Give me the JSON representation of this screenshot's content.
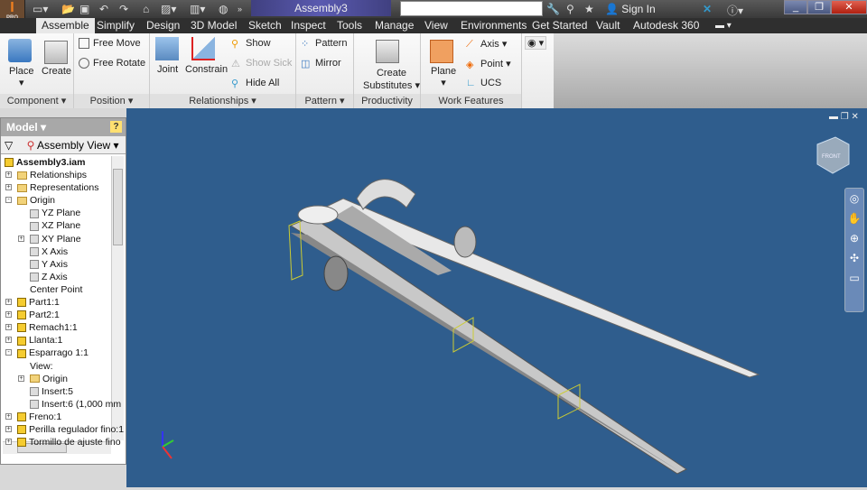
{
  "title_bar": {
    "app_badge": "PRO",
    "document_title": "Assembly3",
    "search_placeholder": "",
    "sign_in": "Sign In"
  },
  "tabs": [
    "Assemble",
    "Simplify",
    "Design",
    "3D Model",
    "Sketch",
    "Inspect",
    "Tools",
    "Manage",
    "View",
    "Environments",
    "Get Started",
    "Vault",
    "Autodesk 360"
  ],
  "active_tab": "Assemble",
  "ribbon": {
    "component": {
      "label": "Component",
      "place": "Place",
      "create": "Create"
    },
    "position": {
      "label": "Position",
      "free_move": "Free Move",
      "free_rotate": "Free Rotate"
    },
    "relationships": {
      "label": "Relationships",
      "joint": "Joint",
      "constrain": "Constrain",
      "show": "Show",
      "show_sick": "Show Sick",
      "hide_all": "Hide All"
    },
    "pattern": {
      "label": "Pattern",
      "pattern": "Pattern",
      "mirror": "Mirror"
    },
    "productivity": {
      "label": "Productivity",
      "create_substitutes_1": "Create",
      "create_substitutes_2": "Substitutes"
    },
    "work_features": {
      "label": "Work Features",
      "plane": "Plane",
      "axis": "Axis",
      "point": "Point",
      "ucs": "UCS"
    }
  },
  "browser": {
    "header": "Model",
    "view": "Assembly View",
    "root": "Assembly3.iam",
    "nodes": [
      "Relationships",
      "Representations",
      "Origin",
      "YZ Plane",
      "XZ Plane",
      "XY Plane",
      "X Axis",
      "Y Axis",
      "Z Axis",
      "Center Point",
      "Part1:1",
      "Part2:1",
      "Remach1:1",
      "Llanta:1",
      "Esparrago 1:1",
      "View:",
      "Origin",
      "Insert:5",
      "Insert:6 (1,000 mm",
      "Freno:1",
      "Perilla regulador fino:1",
      "Tormillo de ajuste fino"
    ]
  },
  "viewcube": {
    "label": "FRONT"
  },
  "colors": {
    "viewport": "#2f5d8d",
    "accent": "#f08020"
  }
}
